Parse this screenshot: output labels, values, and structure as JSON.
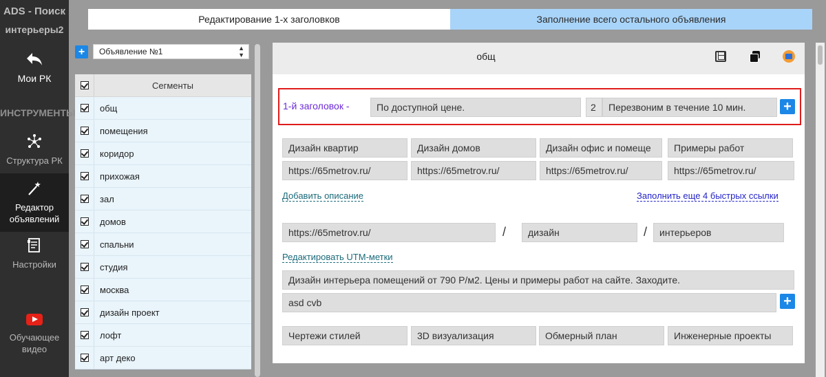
{
  "sidebar": {
    "brand_line1": "ADS - Поиск",
    "brand_line2": "интерьеры2",
    "back_label": "Мои РК",
    "section_title": "ИНСТРУМЕНТЫ",
    "items": [
      {
        "label": "Структура РК",
        "icon": "structure-icon"
      },
      {
        "label": "Редактор объявлений",
        "icon": "magic-wand-icon"
      },
      {
        "label": "Настройки",
        "icon": "settings-doc-icon"
      }
    ],
    "video_label": "Обучающее видео"
  },
  "tabs": [
    {
      "label": "Редактирование 1-х заголовков"
    },
    {
      "label": "Заполнение всего остального объявления"
    }
  ],
  "ad_select": {
    "value": "Объявление №1"
  },
  "segments": {
    "header": "Сегменты",
    "rows": [
      "общ",
      "помещения",
      "коридор",
      "прихожая",
      "зал",
      "домов",
      "спальни",
      "студия",
      "москва",
      "дизайн проект",
      "лофт",
      "арт деко"
    ]
  },
  "editor": {
    "title": "общ",
    "headline": {
      "label": "1-й заголовок -",
      "field1": "По доступной цене.",
      "count": "2",
      "field2": "Перезвоним в течение 10 мин."
    },
    "sitelinks": [
      "Дизайн квартир",
      "Дизайн домов",
      "Дизайн офис и помеще",
      "Примеры работ"
    ],
    "sitelink_urls": [
      "https://65metrov.ru/",
      "https://65metrov.ru/",
      "https://65metrov.ru/",
      "https://65metrov.ru/"
    ],
    "add_description": "Добавить описание",
    "fill_more_links": "Заполнить еще 4 быстрых ссылки",
    "display_url": {
      "base": "https://65metrov.ru/",
      "sep1": "/",
      "path1": "дизайн",
      "sep2": "/",
      "path2": "интерьеров"
    },
    "edit_utm": "Редактировать UTM-метки",
    "text": "Дизайн интерьера помещений от 790 Р/м2. Цены и примеры работ на сайте. Заходите.",
    "extra": "asd cvb",
    "callouts": [
      "Чертежи стилей",
      "3D визуализация",
      "Обмерный план",
      "Инженерные проекты"
    ]
  }
}
